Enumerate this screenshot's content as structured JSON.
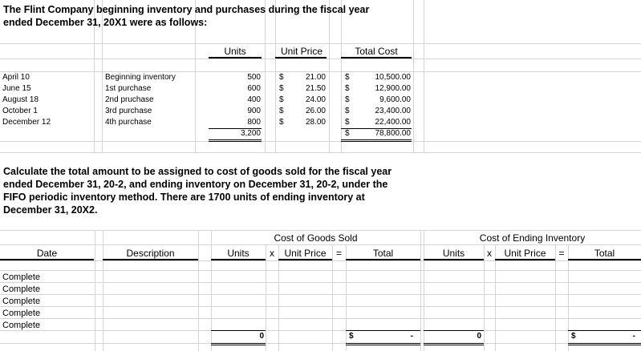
{
  "intro": {
    "line1": "The Flint Company beginning inventory and purchases during the fiscal year",
    "line2": "ended December 31, 20X1 were as follows:"
  },
  "top_headers": {
    "units": "Units",
    "unit_price": "Unit Price",
    "total_cost": "Total Cost"
  },
  "rows": [
    {
      "date": "April 10",
      "desc": "Beginning inventory",
      "units": "500",
      "price": "21.00",
      "total": "10,500.00"
    },
    {
      "date": "June 15",
      "desc": "1st purchase",
      "units": "600",
      "price": "21.50",
      "total": "12,900.00"
    },
    {
      "date": "August 18",
      "desc": "2nd pruchase",
      "units": "400",
      "price": "24.00",
      "total": "9,600.00"
    },
    {
      "date": "October 1",
      "desc": "3rd purchase",
      "units": "900",
      "price": "26.00",
      "total": "23,400.00"
    },
    {
      "date": "December 12",
      "desc": "4th purchase",
      "units": "800",
      "price": "28.00",
      "total": "22,400.00"
    }
  ],
  "currency": "$",
  "totals": {
    "units": "3,200",
    "total": "78,800.00"
  },
  "question": {
    "l1": "Calculate the total amount to be assigned to cost of goods sold for the fiscal year",
    "l2": "ended December 31, 20-2, and ending inventory on December 31, 20-2, under the",
    "l3": "FIFO periodic inventory method.  There are 1700 units of ending inventory at",
    "l4": "December 31, 20X2."
  },
  "answer": {
    "cogs_title": "Cost of Goods Sold",
    "ei_title": "Cost of Ending Inventory",
    "date": "Date",
    "description": "Description",
    "units": "Units",
    "x": "x",
    "unit_price": "Unit Price",
    "eq": "=",
    "total": "Total",
    "rows": [
      "Complete",
      "Complete",
      "Complete",
      "Complete",
      "Complete"
    ],
    "cogs_units_total": "0",
    "cogs_total": "-",
    "ei_units_total": "0",
    "ei_total": "-"
  }
}
